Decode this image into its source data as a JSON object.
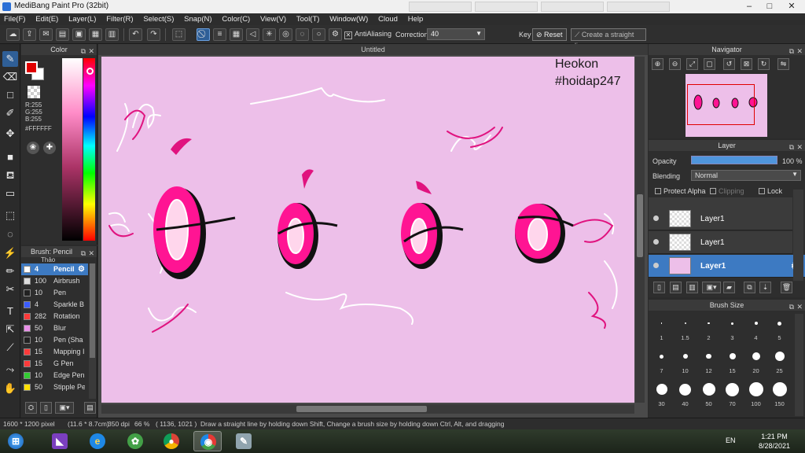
{
  "window": {
    "title": "MediBang Paint Pro (32bit)"
  },
  "menu": [
    "File(F)",
    "Edit(E)",
    "Layer(L)",
    "Filter(R)",
    "Select(S)",
    "Snap(N)",
    "Color(C)",
    "View(V)",
    "Tool(T)",
    "Window(W)",
    "Cloud",
    "Help"
  ],
  "toolbar": {
    "antialiasing_label": "AntiAliasing",
    "correction_label": "Correction",
    "correction_value": "40",
    "key_label": "Key",
    "reset_label": "Reset",
    "straight_line_label": "Create a straight line"
  },
  "color_panel": {
    "title": "Color",
    "r": "R:255",
    "g": "G:255",
    "b": "B:255",
    "hex": "#FFFFFF",
    "foreground": "#e00000",
    "background": "#ffffff"
  },
  "brush_panel": {
    "title": "Brush: Pencil",
    "partial_top": "Thảo",
    "items": [
      {
        "size": "4",
        "name": "Pencil",
        "color": "#ffffff",
        "selected": true
      },
      {
        "size": "100",
        "name": "Airbrush",
        "color": "#dddddd"
      },
      {
        "size": "10",
        "name": "Pen",
        "color": "#222222"
      },
      {
        "size": "4",
        "name": "Sparkle B",
        "color": "#3a5cff"
      },
      {
        "size": "282",
        "name": "Rotation",
        "color": "#ff3a3a"
      },
      {
        "size": "50",
        "name": "Blur",
        "color": "#e890e8"
      },
      {
        "size": "10",
        "name": "Pen (Sha",
        "color": "#222222"
      },
      {
        "size": "15",
        "name": "Mapping I",
        "color": "#ff3a3a"
      },
      {
        "size": "15",
        "name": "G Pen",
        "color": "#ff3a3a"
      },
      {
        "size": "10",
        "name": "Edge Pen",
        "color": "#33cc33"
      },
      {
        "size": "50",
        "name": "Stipple Pe",
        "color": "#ffe000"
      }
    ]
  },
  "canvas": {
    "doc_title": "Untitled",
    "watermark_line1": "Heokon",
    "watermark_line2": "#hoidap247",
    "background": "#edbfe9"
  },
  "navigator": {
    "title": "Navigator"
  },
  "layer_panel": {
    "title": "Layer",
    "opacity_label": "Opacity",
    "opacity_value": "100 %",
    "opacity": 1.0,
    "blending_label": "Blending",
    "blending_value": "Normal",
    "protect_alpha": "Protect Alpha",
    "clipping": "Clipping",
    "lock": "Lock",
    "layers": [
      {
        "name": "Layer1",
        "selected": false
      },
      {
        "name": "Layer1",
        "selected": false
      },
      {
        "name": "Layer1",
        "selected": true
      }
    ]
  },
  "brush_size_panel": {
    "title": "Brush Size",
    "sizes": [
      "1",
      "1.5",
      "2",
      "3",
      "4",
      "5",
      "7",
      "10",
      "12",
      "15",
      "20",
      "25",
      "30",
      "40",
      "50",
      "70",
      "100",
      "150"
    ]
  },
  "status": {
    "size": "1600 * 1200 pixel",
    "dimensions": "(11.6 * 8.7cm)",
    "dpi": "350 dpi",
    "zoom": "66 %",
    "coords": "( 1136, 1021 )",
    "hint": "Draw a straight line by holding down Shift, Change a brush size by holding down Ctrl, Alt, and dragging"
  },
  "taskbar": {
    "language": "EN",
    "time": "1:21 PM",
    "date": "8/28/2021"
  }
}
